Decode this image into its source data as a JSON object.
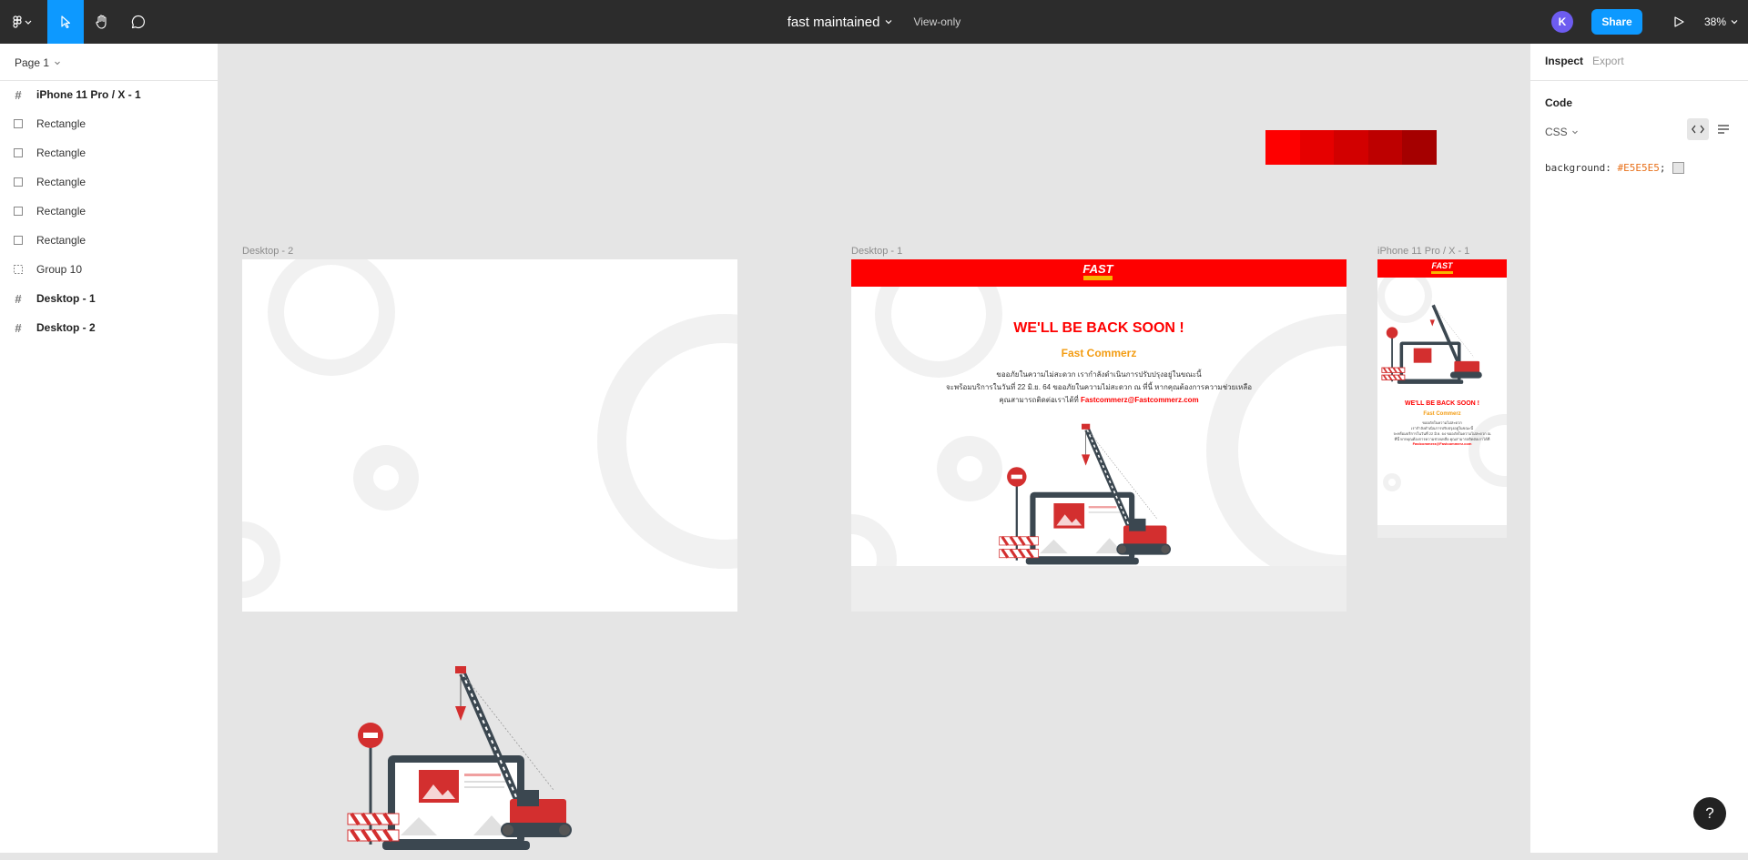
{
  "toolbar": {
    "file_name": "fast maintained",
    "mode": "View-only",
    "avatar_initial": "K",
    "share_label": "Share",
    "zoom": "38%",
    "icons": [
      "figma-menu-icon",
      "move-tool-icon",
      "hand-tool-icon",
      "comment-tool-icon",
      "present-play-icon"
    ]
  },
  "left_panel": {
    "page": "Page 1",
    "layers": [
      {
        "label": "iPhone 11 Pro / X - 1",
        "type": "frame"
      },
      {
        "label": "Rectangle",
        "type": "rectangle"
      },
      {
        "label": "Rectangle",
        "type": "rectangle"
      },
      {
        "label": "Rectangle",
        "type": "rectangle"
      },
      {
        "label": "Rectangle",
        "type": "rectangle"
      },
      {
        "label": "Rectangle",
        "type": "rectangle"
      },
      {
        "label": "Group 10",
        "type": "group"
      },
      {
        "label": "Desktop - 1",
        "type": "frame"
      },
      {
        "label": "Desktop - 2",
        "type": "frame"
      }
    ]
  },
  "right_panel": {
    "tabs": [
      "Inspect",
      "Export"
    ],
    "section": "Code",
    "language": "CSS",
    "code_property": "background:",
    "code_value": "#E5E5E5",
    "code_end": ";"
  },
  "canvas": {
    "background": "#E5E5E5",
    "swatches": [
      "#FE0000",
      "#E60000",
      "#D20000",
      "#BD0000",
      "#A50000"
    ],
    "frames": {
      "desktop2": {
        "label": "Desktop - 2"
      },
      "desktop1": {
        "label": "Desktop - 1",
        "logo": "FAST",
        "title": "WE'LL BE BACK SOON !",
        "subtitle": "Fast Commerz",
        "line1": "ขออภัยในความไม่สะดวก เรากำลังดำเนินการปรับปรุงอยู่ในขณะนี้",
        "line2": "จะพร้อมบริการในวันที่ 22 มิ.ย. 64 ขออภัยในความไม่สะดวก ณ ที่นี้ หากคุณต้องการความช่วยเหลือ",
        "line3_text": "คุณสามารถติดต่อเราได้ที่",
        "email": "Fastcommerz@Fastcommerz.com"
      },
      "iphone": {
        "label": "iPhone 11 Pro / X - 1",
        "logo": "FAST",
        "title": "WE'LL BE BACK SOON !",
        "subtitle": "Fast Commerz",
        "line1": "ขออภัยในความไม่สะดวก",
        "line2": "เรากำลังดำเนินการปรับปรุงอยู่ในขณะนี้",
        "line3": "จะพร้อมบริการในวันที่ 22 มิ.ย. 64 ขออภัยในความไม่สะดวก ณ",
        "line4": "ที่นี้ หากคุณต้องการความช่วยเหลือ คุณสามารถติดต่อเราได้ที่",
        "email": "Fastcommerz@Fastcommerz.com"
      }
    }
  },
  "help_label": "?"
}
